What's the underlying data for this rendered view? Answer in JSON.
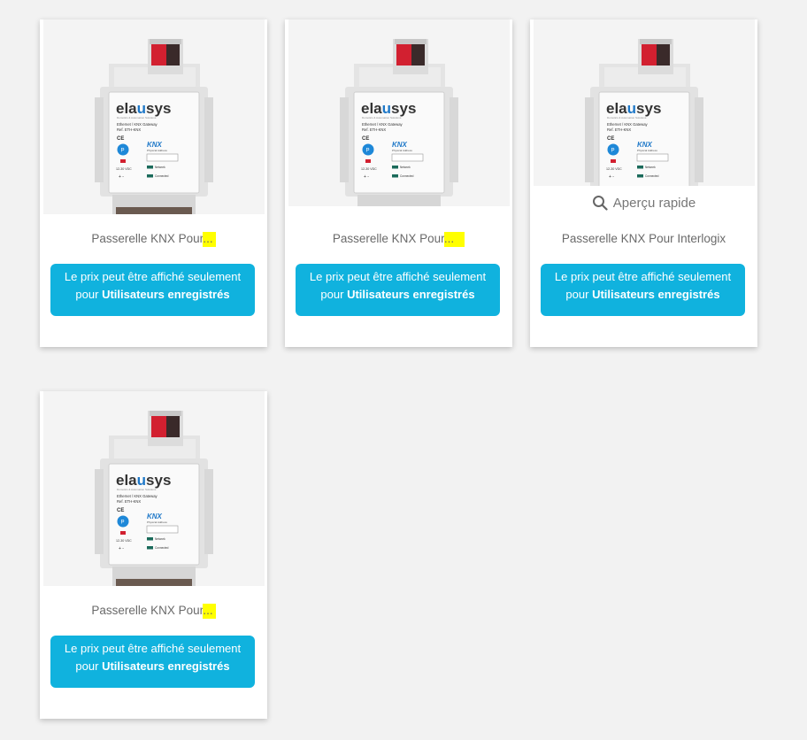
{
  "products": [
    {
      "title": "Passerelle KNX Pour",
      "ellipsis": "...",
      "price_line1": "Le prix peut être affiché seulement",
      "price_line2_prefix": "pour ",
      "price_line2_bold": "Utilisateurs enregistrés"
    },
    {
      "title": "Passerelle KNX Pour",
      "ellipsis": "...",
      "price_line1": "Le prix peut être affiché seulement",
      "price_line2_prefix": "pour ",
      "price_line2_bold": "Utilisateurs enregistrés"
    },
    {
      "title": "Passerelle KNX Pour Interlogix",
      "quick_view": "Aperçu rapide",
      "quick_view_icon": "search-icon",
      "price_line1": "Le prix peut être affiché seulement",
      "price_line2_prefix": "pour ",
      "price_line2_bold": "Utilisateurs enregistrés"
    },
    {
      "title": "Passerelle KNX Pour",
      "ellipsis": "...",
      "price_line1": "Le prix peut être affiché seulement",
      "price_line2_prefix": "pour ",
      "price_line2_bold": "Utilisateurs enregistrés"
    }
  ],
  "device_label": {
    "brand_a": "ela",
    "brand_b": "u",
    "brand_c": "sys",
    "tagline": "Domotics & Automation Solutions",
    "model": "Ethernet / KNX Gateway",
    "ref": "Ref.  ETH-KNX",
    "ce": "CE",
    "p": "P",
    "knx": "KNX",
    "phys": "Physical Address",
    "voltage": "12-30 VDC",
    "network": "Network",
    "connected": "Connected",
    "plusminus": "+   -"
  },
  "colors": {
    "accent": "#10b2de",
    "highlight": "#ffff00",
    "brand_blue": "#1e78c8",
    "terminal_red": "#d22030"
  }
}
